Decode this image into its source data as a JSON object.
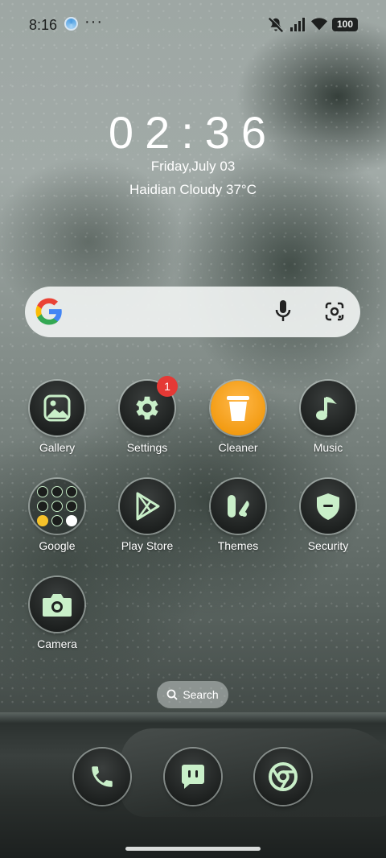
{
  "status_bar": {
    "time": "8:16",
    "more": "···",
    "battery": "100",
    "icons": [
      "app-notification-icon",
      "mute-icon",
      "signal-icon",
      "wifi-icon",
      "battery-icon"
    ]
  },
  "clock_widget": {
    "time": "02:36",
    "date": "Friday,July 03",
    "weather": "Haidian Cloudy 37°C"
  },
  "search_widget": {
    "icons": [
      "google-logo-icon",
      "mic-icon",
      "google-lens-icon"
    ]
  },
  "apps": [
    {
      "label": "Gallery",
      "icon": "gallery-icon"
    },
    {
      "label": "Settings",
      "icon": "gear-icon",
      "badge": "1"
    },
    {
      "label": "Cleaner",
      "icon": "trash-icon"
    },
    {
      "label": "Music",
      "icon": "music-note-icon"
    },
    {
      "label": "Google",
      "icon": "folder-icon"
    },
    {
      "label": "Play Store",
      "icon": "play-store-icon"
    },
    {
      "label": "Themes",
      "icon": "themes-icon"
    },
    {
      "label": "Security",
      "icon": "shield-icon"
    },
    {
      "label": "Camera",
      "icon": "camera-icon"
    }
  ],
  "search_pill": {
    "label": "Search"
  },
  "dock": [
    "phone-icon",
    "messages-icon",
    "chrome-icon"
  ],
  "colors": {
    "accent": "#c9efc9",
    "badge": "#e53935",
    "cleaner": "#f29a10"
  }
}
